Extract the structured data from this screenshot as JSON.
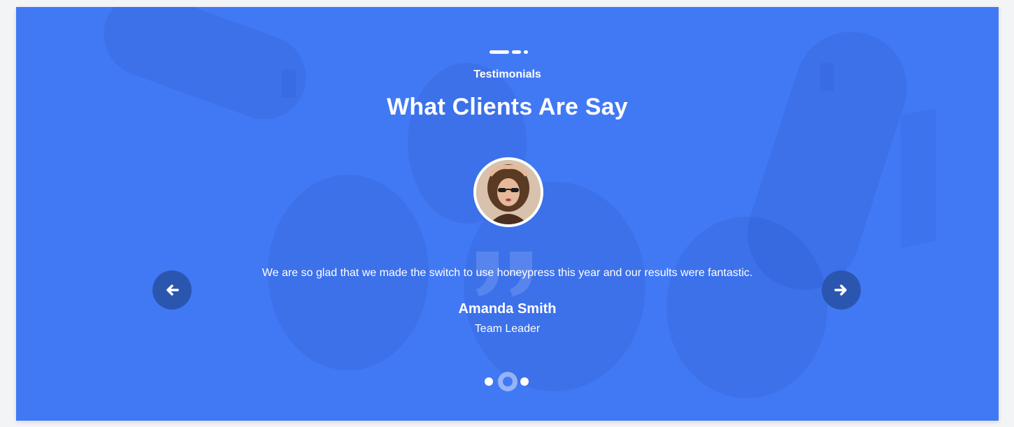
{
  "colors": {
    "section_background": "#4179f5",
    "arrow_background": "#2b56b0",
    "text": "#ffffff"
  },
  "section": {
    "eyebrow": "Testimonials",
    "title": "What Clients Are Say"
  },
  "testimonial": {
    "quote": "We are so glad that we made the switch to use honeypress this year and our results were fantastic.",
    "name": "Amanda Smith",
    "role": "Team Leader",
    "avatar_icon": "user-photo"
  },
  "navigation": {
    "prev_icon": "arrow-left-icon",
    "next_icon": "arrow-right-icon",
    "slide_count": 3,
    "active_slide": 2
  }
}
